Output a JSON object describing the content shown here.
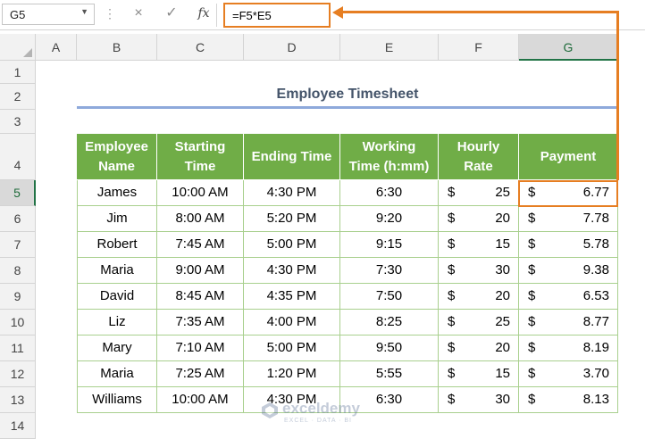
{
  "name_box": {
    "value": "G5"
  },
  "formula_bar": {
    "cancel_icon": "×",
    "enter_icon": "✓",
    "function_icon": "fx",
    "formula": "=F5*E5"
  },
  "columns": [
    "A",
    "B",
    "C",
    "D",
    "E",
    "F",
    "G"
  ],
  "selected_column": "G",
  "rows": [
    "1",
    "2",
    "3",
    "4",
    "5",
    "6",
    "7",
    "8",
    "9",
    "10",
    "11",
    "12",
    "13",
    "14"
  ],
  "selected_row": "5",
  "sheet": {
    "title": "Employee Timesheet",
    "headers": {
      "name_l1": "Employee",
      "name_l2": "Name",
      "start_l1": "Starting",
      "start_l2": "Time",
      "end": "Ending Time",
      "work_l1": "Working",
      "work_l2": "Time (h:mm)",
      "rate_l1": "Hourly",
      "rate_l2": "Rate",
      "payment": "Payment"
    },
    "currency_symbol": "$",
    "records": [
      {
        "name": "James",
        "start": "10:00 AM",
        "end": "4:30 PM",
        "work": "6:30",
        "rate": "25",
        "pay": "6.77"
      },
      {
        "name": "Jim",
        "start": "8:00 AM",
        "end": "5:20 PM",
        "work": "9:20",
        "rate": "20",
        "pay": "7.78"
      },
      {
        "name": "Robert",
        "start": "7:45 AM",
        "end": "5:00 PM",
        "work": "9:15",
        "rate": "15",
        "pay": "5.78"
      },
      {
        "name": "Maria",
        "start": "9:00 AM",
        "end": "4:30 PM",
        "work": "7:30",
        "rate": "30",
        "pay": "9.38"
      },
      {
        "name": "David",
        "start": "8:45 AM",
        "end": "4:35 PM",
        "work": "7:50",
        "rate": "20",
        "pay": "6.53"
      },
      {
        "name": "Liz",
        "start": "7:35 AM",
        "end": "4:00 PM",
        "work": "8:25",
        "rate": "25",
        "pay": "8.77"
      },
      {
        "name": "Mary",
        "start": "7:10 AM",
        "end": "5:00 PM",
        "work": "9:50",
        "rate": "20",
        "pay": "8.19"
      },
      {
        "name": "Maria",
        "start": "7:25 AM",
        "end": "1:20 PM",
        "work": "5:55",
        "rate": "15",
        "pay": "3.70"
      },
      {
        "name": "Williams",
        "start": "10:00 AM",
        "end": "4:30 PM",
        "work": "6:30",
        "rate": "30",
        "pay": "8.13"
      }
    ]
  },
  "watermark": {
    "name": "exceldemy",
    "tagline": "EXCEL · DATA · BI"
  },
  "colors": {
    "header_green": "#70ad47",
    "highlight_orange": "#e67e22",
    "title_color": "#44546a"
  }
}
